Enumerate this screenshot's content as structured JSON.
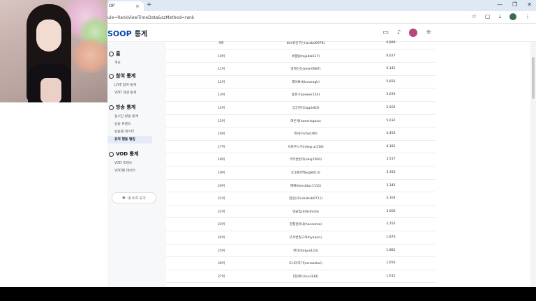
{
  "browser": {
    "tab_title": "OP",
    "tab_close": "×",
    "new_tab": "+",
    "url": "ule=RankViewTimeData&szMethod=rank",
    "window_controls": [
      "—",
      "❐",
      "✕"
    ]
  },
  "header": {
    "logo_brand": "SOOP",
    "logo_sub": "통계"
  },
  "sidebar": {
    "home": {
      "title": "홈",
      "items": [
        "개요"
      ]
    },
    "participation": {
      "title": "참여 통계",
      "items": [
        "LIVE 참여 통계",
        "VOD 재생 통계"
      ]
    },
    "broadcast": {
      "title": "방송 통계",
      "items": [
        "실시간 방송 통계",
        "방송 트렌드",
        "방송별 데이터",
        "유저 행동 랭킹"
      ],
      "active_index": 3
    },
    "vod": {
      "title": "VOD 통계",
      "items": [
        "VOD 트렌드",
        "VOD별 데이터"
      ]
    },
    "my_list_button": "내 수치 보기"
  },
  "ranking": {
    "rows": [
      {
        "rank": "9위",
        "name": "this위신구는(wrabd0978)",
        "value": "6,889"
      },
      {
        "rank": "10위",
        "name": "#햄링(tajabla617)",
        "value": "6,627"
      },
      {
        "rank": "11위",
        "name": "얼렌신신(zeen0987)",
        "value": "6,141"
      },
      {
        "rank": "12위",
        "name": "해아MH(kmaragh)",
        "value": "5,692"
      },
      {
        "rank": "13위",
        "name": "용흥구(jaewer154)",
        "value": "5,633"
      },
      {
        "rank": "14위",
        "name": "궁궁번다(apple83)",
        "value": "5,502"
      },
      {
        "rank": "15위",
        "name": "여든게(hoeenkgaro)",
        "value": "5,032"
      },
      {
        "rank": "16위",
        "name": "엉세구(che190)",
        "value": "4,454"
      },
      {
        "rank": "17위",
        "name": "사자우스기(niteg ur218)",
        "value": "4,181"
      },
      {
        "rank": "18위",
        "name": "부터번번미(okaj2500)",
        "value": "3,517"
      },
      {
        "rank": "19위",
        "name": "[C]세마케(jsg8413)",
        "value": "3,350"
      },
      {
        "rank": "20위",
        "name": "깨캐(itsnstdoc1111)",
        "value": "3,345"
      },
      {
        "rank": "21위",
        "name": "[정]는호(vbxbvb0711)",
        "value": "3,164"
      },
      {
        "rank": "22위",
        "name": "병균임(dhkdmda)",
        "value": "3,006"
      },
      {
        "rank": "23위",
        "name": "현창원아내(hancoma)",
        "value": "2,252"
      },
      {
        "rank": "24위",
        "name": "뜨우번필구로(hyaaun)",
        "value": "1,870"
      },
      {
        "rank": "25위",
        "name": "한다(forgue123)",
        "value": "1,881"
      },
      {
        "rank": "26위",
        "name": "도사아하기(sonazolari)",
        "value": "1,656"
      },
      {
        "rank": "27위",
        "name": "[정]바나(our334)",
        "value": "1,612"
      }
    ]
  }
}
